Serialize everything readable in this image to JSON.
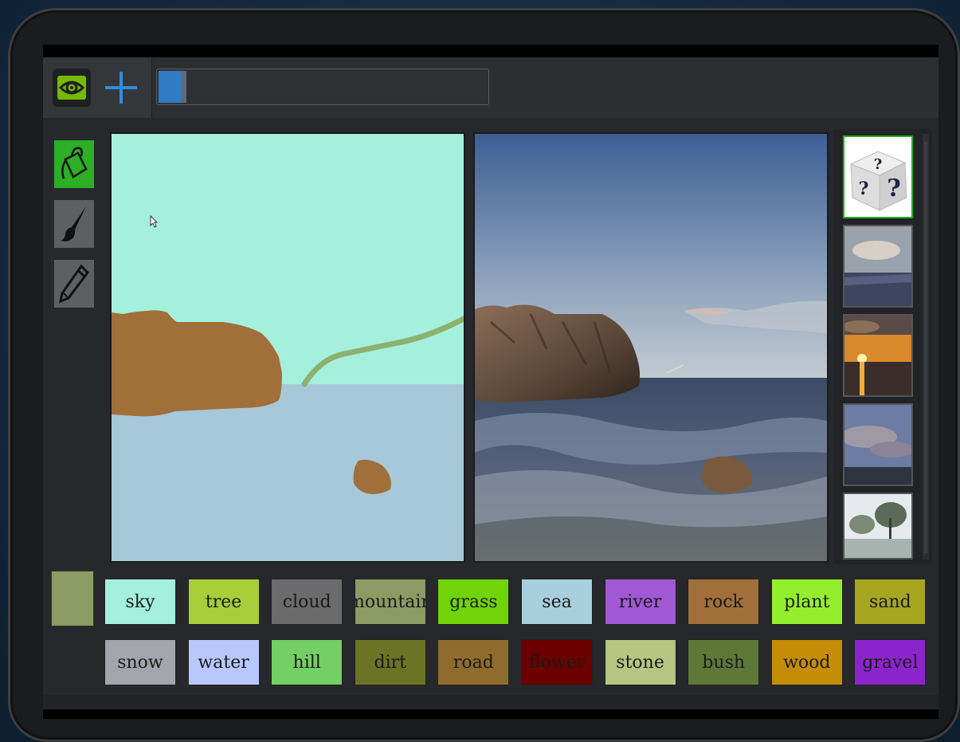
{
  "app": {
    "progress_percent": 7
  },
  "icons": {
    "logo": "nvidia-eye-icon",
    "add": "plus-icon",
    "fill_tool": "paint-bucket-icon",
    "brush_tool": "paintbrush-icon",
    "pencil_tool": "pencil-icon",
    "random_style": "dice-icon"
  },
  "colors": {
    "accent_green": "#2cae26",
    "progress_blue": "#2f7cc4",
    "current_swatch": "#8c9a63"
  },
  "palette": [
    {
      "label": "sky",
      "color": "#a4f0dd"
    },
    {
      "label": "tree",
      "color": "#a6cf3a"
    },
    {
      "label": "cloud",
      "color": "#6b6b6b"
    },
    {
      "label": "mountain",
      "color": "#8c9a63"
    },
    {
      "label": "grass",
      "color": "#70d408"
    },
    {
      "label": "sea",
      "color": "#a8cfdc"
    },
    {
      "label": "river",
      "color": "#a058d4"
    },
    {
      "label": "rock",
      "color": "#a06f3a"
    },
    {
      "label": "plant",
      "color": "#93ef2c"
    },
    {
      "label": "sand",
      "color": "#a6a621"
    },
    {
      "label": "snow",
      "color": "#a4a4ac"
    },
    {
      "label": "water",
      "color": "#b8c8ff"
    },
    {
      "label": "hill",
      "color": "#74d064"
    },
    {
      "label": "dirt",
      "color": "#6b7424"
    },
    {
      "label": "road",
      "color": "#8f6c2c"
    },
    {
      "label": "flower",
      "color": "#6c0000"
    },
    {
      "label": "stone",
      "color": "#b8c482"
    },
    {
      "label": "bush",
      "color": "#5e7838"
    },
    {
      "label": "wood",
      "color": "#c58d06"
    },
    {
      "label": "gravel",
      "color": "#8c24cc"
    }
  ],
  "style_thumbnails": [
    "random",
    "cloudy-city",
    "sunset-sea",
    "dusk-sky",
    "misty-trees"
  ]
}
